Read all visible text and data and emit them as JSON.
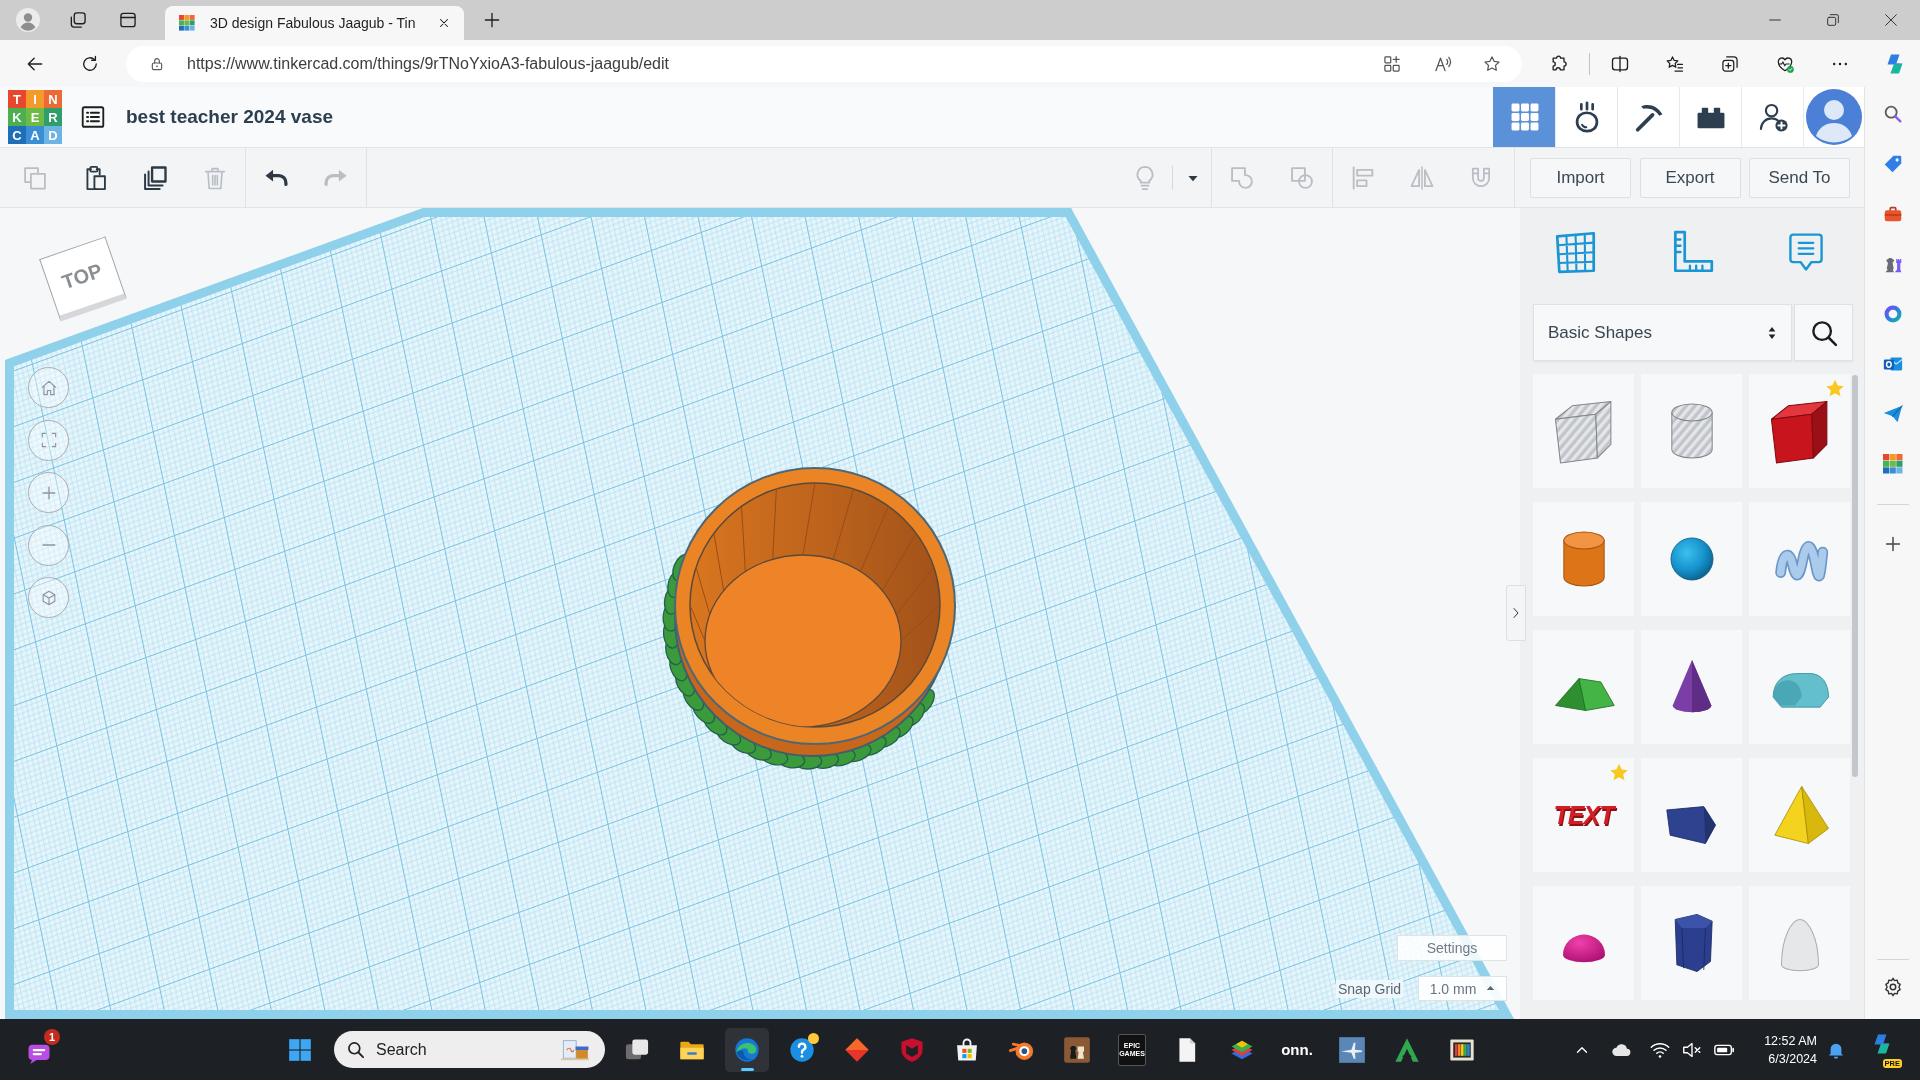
{
  "browser": {
    "tab": {
      "title": "3D design Fabulous Jaagub - Tin"
    },
    "url": "https://www.tinkercad.com/things/9rTNoYxioA3-fabulous-jaagub/edit"
  },
  "header": {
    "logo": [
      {
        "letter": "T",
        "color": "#e8472f"
      },
      {
        "letter": "I",
        "color": "#f39a2b"
      },
      {
        "letter": "N",
        "color": "#ec6a35"
      },
      {
        "letter": "K",
        "color": "#4caf50"
      },
      {
        "letter": "E",
        "color": "#6dbb45"
      },
      {
        "letter": "R",
        "color": "#2e9e6b"
      },
      {
        "letter": "C",
        "color": "#1f6fb8"
      },
      {
        "letter": "A",
        "color": "#3a8fd4"
      },
      {
        "letter": "D",
        "color": "#6cb4e4"
      }
    ],
    "title": "best teacher 2024 vase",
    "modes": [
      {
        "kind": "grid",
        "selected": true
      },
      {
        "kind": "ball",
        "selected": false
      },
      {
        "kind": "pickaxe",
        "selected": false
      },
      {
        "kind": "bricks",
        "selected": false
      }
    ]
  },
  "toolbar": {
    "edit": [
      {
        "kind": "copy",
        "disabled": true
      },
      {
        "kind": "paste",
        "disabled": false
      },
      {
        "kind": "duplicate",
        "disabled": false
      },
      {
        "kind": "delete",
        "disabled": true
      }
    ],
    "history": [
      {
        "kind": "undo",
        "disabled": false
      },
      {
        "kind": "redo",
        "disabled": true
      }
    ],
    "tools": [
      {
        "kind": "bulb",
        "disabled": true
      },
      {
        "kind": "dropdown",
        "disabled": false
      },
      {
        "kind": "group",
        "disabled": true
      },
      {
        "kind": "ungroup",
        "disabled": true
      },
      {
        "kind": "align",
        "disabled": true
      },
      {
        "kind": "mirror",
        "disabled": true
      },
      {
        "kind": "magnet",
        "disabled": true
      }
    ],
    "actions": [
      "Import",
      "Export",
      "Send To"
    ]
  },
  "workplane": {
    "view_cube": "TOP",
    "settings": "Settings",
    "snap_grid": {
      "label": "Snap Grid",
      "value": "1.0 mm"
    }
  },
  "library": {
    "category": "Basic Shapes",
    "shapes": [
      {
        "kind": "boxhole",
        "starred": false
      },
      {
        "kind": "cylinderhole",
        "starred": false
      },
      {
        "kind": "box",
        "starred": true
      },
      {
        "kind": "cylinder",
        "starred": false
      },
      {
        "kind": "sphere",
        "starred": false
      },
      {
        "kind": "scribble",
        "starred": false
      },
      {
        "kind": "roof",
        "starred": false
      },
      {
        "kind": "cone",
        "starred": false
      },
      {
        "kind": "roundroof",
        "starred": false
      },
      {
        "kind": "text",
        "starred": true,
        "label": "TEXT"
      },
      {
        "kind": "wedge",
        "starred": false
      },
      {
        "kind": "pyramid",
        "starred": false
      },
      {
        "kind": "halfsphere",
        "starred": false
      },
      {
        "kind": "polygon",
        "starred": false
      },
      {
        "kind": "paraboloid",
        "starred": false
      }
    ]
  },
  "taskbar": {
    "chat_badge": "1",
    "search": {
      "label": "Search"
    },
    "apps": [
      {
        "kind": "taskview",
        "active": false,
        "alert": false
      },
      {
        "kind": "explorer",
        "active": false,
        "alert": false
      },
      {
        "kind": "edge",
        "active": true,
        "alert": false
      },
      {
        "kind": "help",
        "active": false,
        "alert": true
      },
      {
        "kind": "diamond",
        "active": false,
        "alert": false
      },
      {
        "kind": "shield",
        "active": false,
        "alert": false
      },
      {
        "kind": "store",
        "active": false,
        "alert": false
      },
      {
        "kind": "blender",
        "active": false,
        "alert": false
      },
      {
        "kind": "chess",
        "active": false,
        "alert": false
      },
      {
        "kind": "epic",
        "active": false,
        "alert": false,
        "label": "EPIC GAMES"
      },
      {
        "kind": "file",
        "active": false,
        "alert": false
      },
      {
        "kind": "layers",
        "active": false,
        "alert": false
      },
      {
        "kind": "onn",
        "active": false,
        "alert": false,
        "label": "onn."
      },
      {
        "kind": "plane",
        "active": false,
        "alert": false
      },
      {
        "kind": "peak",
        "active": false,
        "alert": false
      },
      {
        "kind": "bars",
        "active": false,
        "alert": false
      }
    ],
    "clock": {
      "time": "12:52 AM",
      "date": "6/3/2024"
    },
    "copilot_label": "PRE"
  }
}
